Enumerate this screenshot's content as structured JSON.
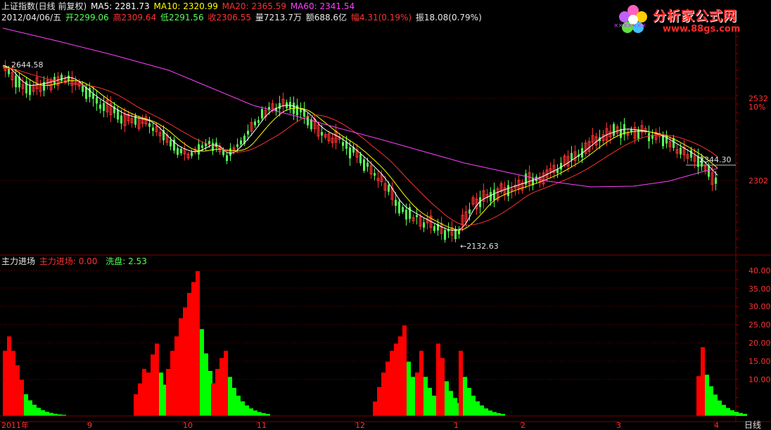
{
  "top_header": {
    "title": "上证指数(日线 前复权)",
    "ma5": "MA5: 2281.73",
    "ma10": "MA10: 2320.99",
    "ma20": "MA20: 2365.59",
    "ma60": "MA60: 2341.54"
  },
  "info_row": {
    "date": "2012/04/06/五",
    "open": "开2299.06",
    "high": "高2309.64",
    "low": "低2291.56",
    "close": "收2306.55",
    "volume": "量7213.7万",
    "amount": "额688.6亿",
    "change": "幅4.31(0.19%)",
    "amplitude": "振18.08(0.79%)"
  },
  "logo": {
    "name": "分析家公式网",
    "url": "www.88gs.com",
    "marks": "×××××××"
  },
  "price_axis": {
    "labels": [
      "2532",
      "10%",
      "2302"
    ],
    "last_price_label": "2344.30",
    "high_marker": "2644.58",
    "low_marker": "←2132.63"
  },
  "indicator": {
    "name": "主力进场",
    "item1": "主力进场: 0.00",
    "item2": "洗盘: 2.53",
    "axis_labels": [
      "40.00",
      "35.00",
      "30.00",
      "25.00",
      "20.00",
      "15.00",
      "10.00"
    ]
  },
  "date_axis": {
    "labels": [
      "2011年",
      "9",
      "10",
      "11",
      "12",
      "1",
      "2",
      "3",
      "4"
    ],
    "period_label": "日线"
  },
  "colors": {
    "up": "#ff3232",
    "down": "#55ff55",
    "ma5": "#ffffff",
    "ma10": "#ffff00",
    "ma20": "#ff3030",
    "ma60": "#ff40ff",
    "grid": "#800000",
    "indicator_red": "#ff0000",
    "indicator_green": "#00ff00"
  }
}
